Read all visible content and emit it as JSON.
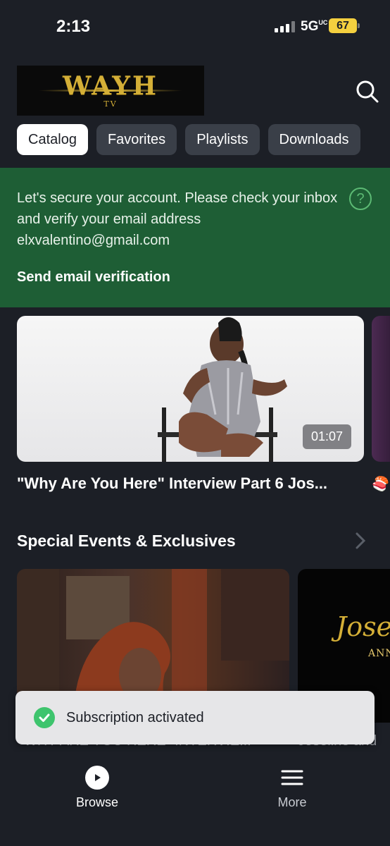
{
  "status_bar": {
    "time": "2:13",
    "network": "5G",
    "network_suffix": "UC",
    "battery": "67"
  },
  "header": {
    "logo_text": "WAYH",
    "logo_sub": "TV"
  },
  "tabs": [
    {
      "label": "Catalog",
      "active": true
    },
    {
      "label": "Favorites",
      "active": false
    },
    {
      "label": "Playlists",
      "active": false
    },
    {
      "label": "Downloads",
      "active": false
    }
  ],
  "banner": {
    "message": "Let's secure your account. Please check your inbox and verify your email address elxvalentino@gmail.com",
    "action": "Send email verification",
    "help_icon": "question-circle-icon",
    "color": "#1e5e35"
  },
  "featured": {
    "duration": "01:07",
    "title": "\"Why Are You Here\" Interview Part 6 Jos...",
    "next_emoji": "🍣"
  },
  "section": {
    "title": "Special Events & Exclusives",
    "cards": [
      {
        "label": "WHY ARE YOU HERE\" INTERVIE..."
      },
      {
        "label": "Joseline and",
        "art_text": "Josel",
        "art_sub": "ANN"
      }
    ]
  },
  "toast": {
    "text": "Subscription activated",
    "icon": "check-circle-icon",
    "color": "#3ec46d"
  },
  "bottom_nav": [
    {
      "label": "Browse",
      "icon": "play-circle-icon"
    },
    {
      "label": "More",
      "icon": "menu-icon"
    }
  ]
}
